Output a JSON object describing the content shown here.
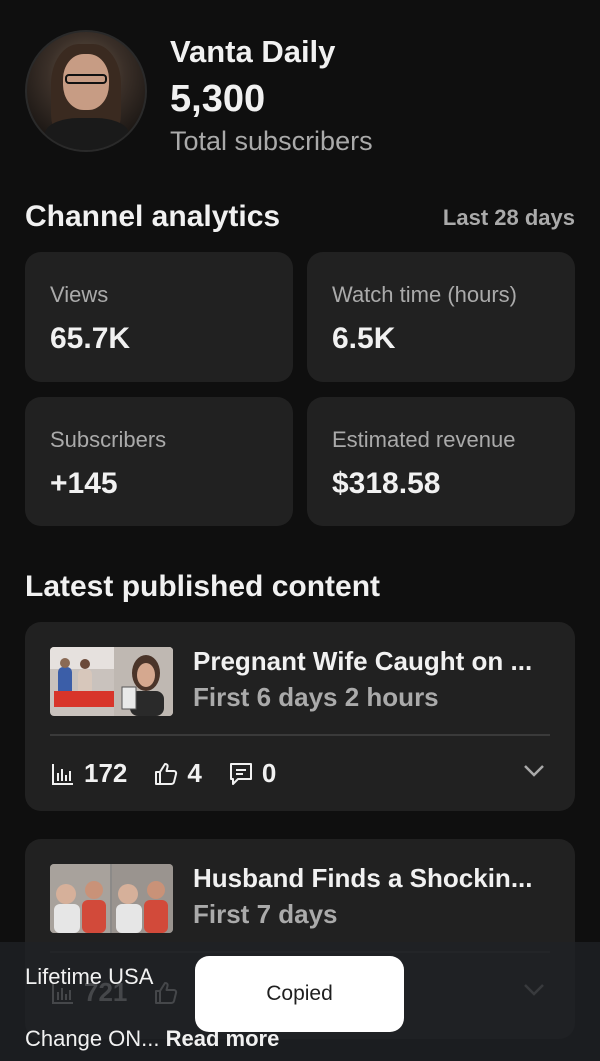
{
  "channel": {
    "name": "Vanta Daily",
    "subscribers": "5,300",
    "subscribers_label": "Total subscribers"
  },
  "analytics": {
    "title": "Channel analytics",
    "range": "Last 28 days",
    "metrics": [
      {
        "label": "Views",
        "value": "65.7K"
      },
      {
        "label": "Watch time (hours)",
        "value": "6.5K"
      },
      {
        "label": "Subscribers",
        "value": "+145"
      },
      {
        "label": "Estimated revenue",
        "value": "$318.58"
      }
    ]
  },
  "latest": {
    "title": "Latest published content",
    "items": [
      {
        "title": "Pregnant Wife Caught on ...",
        "subtitle": "First 6 days 2 hours",
        "views": "172",
        "likes": "4",
        "comments": "0"
      },
      {
        "title": "Husband Finds a Shockin...",
        "subtitle": "First 7 days",
        "views": "721"
      }
    ]
  },
  "overlay": {
    "line1": "Lifetime USA",
    "line2": "Change ON...",
    "read_more": "Read more"
  },
  "toast": {
    "text": "Copied"
  },
  "colors": {
    "background": "#0f0f0f",
    "card": "#212121",
    "secondary_text": "#aaaaaa"
  }
}
